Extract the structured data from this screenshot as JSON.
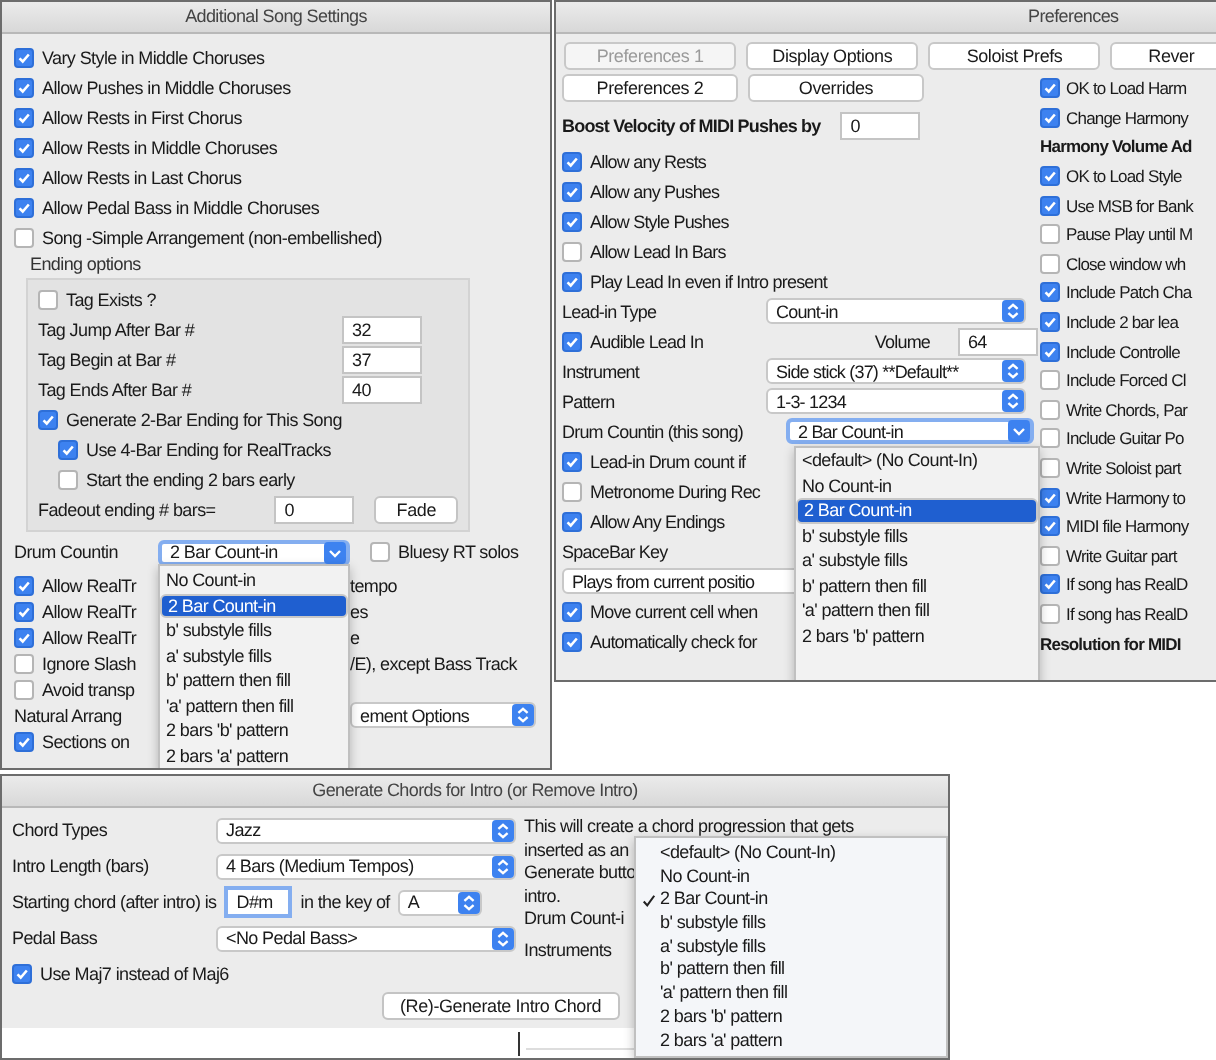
{
  "song_settings": {
    "title": "Additional Song Settings",
    "options": [
      {
        "label": "Vary Style in Middle Choruses",
        "checked": true
      },
      {
        "label": "Allow Pushes in Middle Choruses",
        "checked": true
      },
      {
        "label": "Allow Rests in First Chorus",
        "checked": true
      },
      {
        "label": "Allow Rests in Middle Choruses",
        "checked": true
      },
      {
        "label": "Allow Rests in Last Chorus",
        "checked": true
      },
      {
        "label": "Allow Pedal Bass in Middle Choruses",
        "checked": true
      },
      {
        "label": "Song -Simple Arrangement (non-embellished)",
        "checked": false
      }
    ],
    "ending_options": {
      "heading": "Ending options",
      "tag_exists": {
        "label": "Tag Exists ?",
        "checked": false
      },
      "fields": [
        {
          "label": "Tag Jump After Bar #",
          "value": "32"
        },
        {
          "label": "Tag Begin at Bar #",
          "value": "37"
        },
        {
          "label": "Tag Ends After Bar #",
          "value": "40"
        }
      ],
      "generate": {
        "label": "Generate 2-Bar Ending for This Song",
        "checked": true,
        "children": [
          {
            "label": "Use 4-Bar Ending for RealTracks",
            "checked": true
          },
          {
            "label": "Start the ending 2 bars early",
            "checked": false
          }
        ]
      },
      "fadeout": {
        "label": "Fadeout ending # bars=",
        "value": "0",
        "button": "Fade"
      }
    },
    "drum_countin": {
      "label": "Drum Countin",
      "value": "2 Bar Count-in",
      "menu": [
        {
          "label": "No Count-in",
          "selected": false
        },
        {
          "label": "2 Bar Count-in",
          "selected": true
        },
        {
          "label": "b' substyle fills",
          "selected": false
        },
        {
          "label": "a' substyle fills",
          "selected": false
        },
        {
          "label": "b' pattern then fill",
          "selected": false
        },
        {
          "label": "'a' pattern then fill",
          "selected": false
        },
        {
          "label": "2 bars 'b' pattern",
          "selected": false
        },
        {
          "label": "2 bars 'a' pattern",
          "selected": false
        }
      ]
    },
    "bluesy": {
      "label": "Bluesy RT solos",
      "checked": false
    },
    "more_options": [
      {
        "kind": "check",
        "label": "Allow RealTr",
        "tail": "tempo",
        "checked": true
      },
      {
        "kind": "check",
        "label": "Allow RealTr",
        "tail": "es",
        "checked": true
      },
      {
        "kind": "check",
        "label": "Allow RealTr",
        "tail": "e",
        "checked": true
      },
      {
        "kind": "check",
        "label": "Ignore Slash",
        "tail": "/E), except Bass Track",
        "checked": false
      },
      {
        "kind": "check",
        "label": "Avoid transp",
        "checked": false
      },
      {
        "kind": "select",
        "label": "Natural Arrang",
        "tail": "ement Options"
      },
      {
        "kind": "check",
        "label": "Sections on",
        "checked": true
      }
    ]
  },
  "preferences": {
    "title": "Preferences",
    "tab_rows": [
      {
        "tabs": [
          {
            "label": "Preferences 1",
            "selected": true
          },
          {
            "label": "Display Options",
            "selected": false
          },
          {
            "label": "Soloist Prefs",
            "selected": false
          },
          {
            "label": "Rever",
            "selected": false
          }
        ]
      },
      {
        "tabs": [
          {
            "label": "Preferences 2",
            "selected": false
          },
          {
            "label": "Overrides",
            "selected": false
          }
        ]
      }
    ],
    "boost": {
      "label": "Boost Velocity of MIDI Pushes by",
      "value": "0"
    },
    "checks": [
      {
        "label": "Allow any Rests",
        "checked": true
      },
      {
        "label": "Allow any Pushes",
        "checked": true
      },
      {
        "label": "Allow Style Pushes",
        "checked": true
      },
      {
        "label": "Allow Lead In Bars",
        "checked": false
      },
      {
        "label": "Play Lead In even if Intro present",
        "checked": true
      }
    ],
    "lead_in_type": {
      "label": "Lead-in Type",
      "value": "Count-in"
    },
    "audible": {
      "label": "Audible Lead In",
      "checked": true
    },
    "volume": {
      "label": "Volume",
      "value": "64"
    },
    "instrument": {
      "label": "Instrument",
      "value": "Side stick (37) **Default**"
    },
    "pattern": {
      "label": "Pattern",
      "value": "1-3- 1234"
    },
    "drum_countin": {
      "label": "Drum Countin (this song)",
      "value": "2 Bar Count-in",
      "menu": [
        {
          "label": "<default> (No Count-In)",
          "selected": false
        },
        {
          "label": "No Count-in",
          "selected": false
        },
        {
          "label": "2 Bar Count-in",
          "selected": true
        },
        {
          "label": "b' substyle fills",
          "selected": false
        },
        {
          "label": "a' substyle fills",
          "selected": false
        },
        {
          "label": "b' pattern then fill",
          "selected": false
        },
        {
          "label": "'a' pattern then fill",
          "selected": false
        },
        {
          "label": "2 bars 'b' pattern",
          "selected": false
        }
      ]
    },
    "lower_checks": [
      {
        "label": "Lead-in Drum count if",
        "checked": true
      },
      {
        "label": "Metronome During Rec",
        "checked": false
      },
      {
        "label": "Allow Any Endings",
        "checked": true
      }
    ],
    "spacebar": {
      "label": "SpaceBar Key",
      "value": "Plays from current positio"
    },
    "last_checks": [
      {
        "label": "Move current cell when",
        "checked": true
      },
      {
        "label": "Automatically check for",
        "checked": true
      }
    ],
    "right_column": [
      {
        "kind": "check",
        "label": "OK to Load Harm",
        "checked": true
      },
      {
        "kind": "check",
        "label": "Change Harmony",
        "checked": true
      },
      {
        "kind": "heading",
        "label": "Harmony Volume Ad"
      },
      {
        "kind": "check",
        "label": "OK to Load Style",
        "checked": true
      },
      {
        "kind": "check",
        "label": "Use MSB for Bank",
        "checked": true
      },
      {
        "kind": "check",
        "label": "Pause Play until M",
        "checked": false
      },
      {
        "kind": "check",
        "label": "Close window wh",
        "checked": false
      },
      {
        "kind": "check",
        "label": "Include Patch Cha",
        "checked": true
      },
      {
        "kind": "check",
        "label": "Include 2 bar lea",
        "checked": true
      },
      {
        "kind": "check",
        "label": "Include Controlle",
        "checked": true
      },
      {
        "kind": "check",
        "label": "Include Forced Cl",
        "checked": false
      },
      {
        "kind": "check",
        "label": "Write Chords, Par",
        "checked": false
      },
      {
        "kind": "check",
        "label": "Include Guitar Po",
        "checked": false
      },
      {
        "kind": "check",
        "label": "Write Soloist part",
        "checked": false
      },
      {
        "kind": "check",
        "label": "Write Harmony to",
        "checked": true
      },
      {
        "kind": "check",
        "label": "MIDI file Harmony",
        "checked": true
      },
      {
        "kind": "check",
        "label": "Write Guitar part",
        "checked": false
      },
      {
        "kind": "check",
        "label": "If song has RealD",
        "checked": true
      },
      {
        "kind": "check",
        "label": "If song has RealD",
        "checked": false
      },
      {
        "kind": "heading",
        "label": "Resolution for MIDI"
      }
    ]
  },
  "intro_chords": {
    "title": "Generate Chords for Intro (or Remove Intro)",
    "chord_types": {
      "label": "Chord Types",
      "value": "Jazz"
    },
    "intro_length": {
      "label": "Intro Length (bars)",
      "value": "4 Bars (Medium Tempos)"
    },
    "starting_chord": {
      "label": "Starting chord (after intro) is",
      "value": "D#m",
      "key_label": "in the key of",
      "key": "A"
    },
    "pedal_bass": {
      "label": "Pedal Bass",
      "value": "<No Pedal Bass>"
    },
    "maj7": {
      "label": "Use Maj7 instead of Maj6",
      "checked": true
    },
    "generate_button": "(Re)-Generate Intro Chord",
    "description": [
      "This will create a chord progression that gets",
      "inserted as an",
      "Generate butto",
      "intro."
    ],
    "drum_countin": {
      "label": "Drum Count-i",
      "menu": [
        {
          "label": "<default> (No Count-In)",
          "selected": false
        },
        {
          "label": "No Count-in",
          "selected": false
        },
        {
          "label": "2 Bar Count-in",
          "selected": true
        },
        {
          "label": "b' substyle fills",
          "selected": false
        },
        {
          "label": "a' substyle fills",
          "selected": false
        },
        {
          "label": "b' pattern then fill",
          "selected": false
        },
        {
          "label": "'a' pattern then fill",
          "selected": false
        },
        {
          "label": "2 bars 'b' pattern",
          "selected": false
        },
        {
          "label": "2 bars 'a' pattern",
          "selected": false
        }
      ]
    },
    "instruments_label": "Instruments"
  }
}
